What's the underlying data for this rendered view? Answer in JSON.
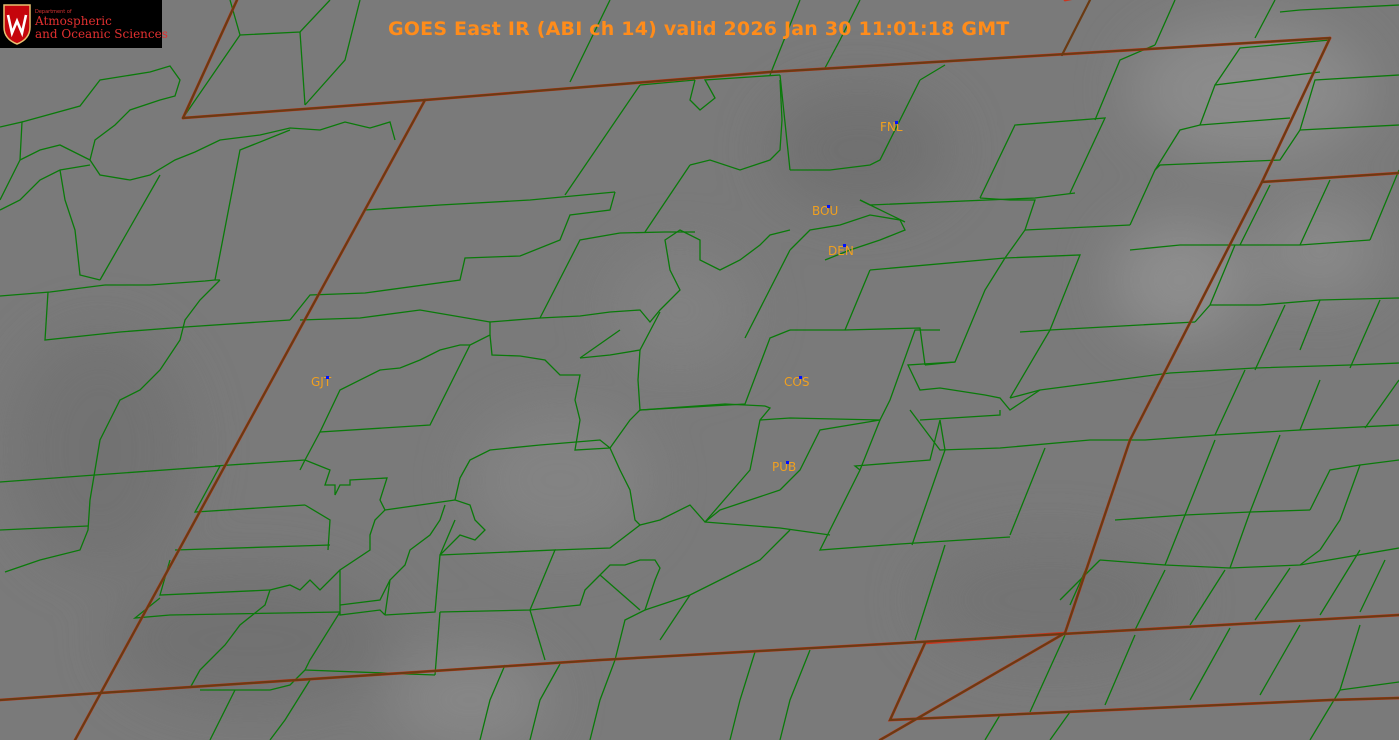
{
  "title": "GOES East IR (ABI ch 14) valid 2026 Jan 30 11:01:18 GMT",
  "logo": {
    "dept": "Department of",
    "line1": "Atmospheric",
    "line2": "and Oceanic Sciences"
  },
  "stations": [
    {
      "id": "FNL"
    },
    {
      "id": "BOU"
    },
    {
      "id": "DEN"
    },
    {
      "id": "GJT"
    },
    {
      "id": "COS"
    },
    {
      "id": "PUB"
    }
  ],
  "colors": {
    "background": "#7a7a7a",
    "county_lines": "#0a7a0a",
    "state_lines": "#8a3a10",
    "title": "#ff8c1a",
    "station_label": "#f0a020",
    "station_marker": "#0010ff"
  }
}
